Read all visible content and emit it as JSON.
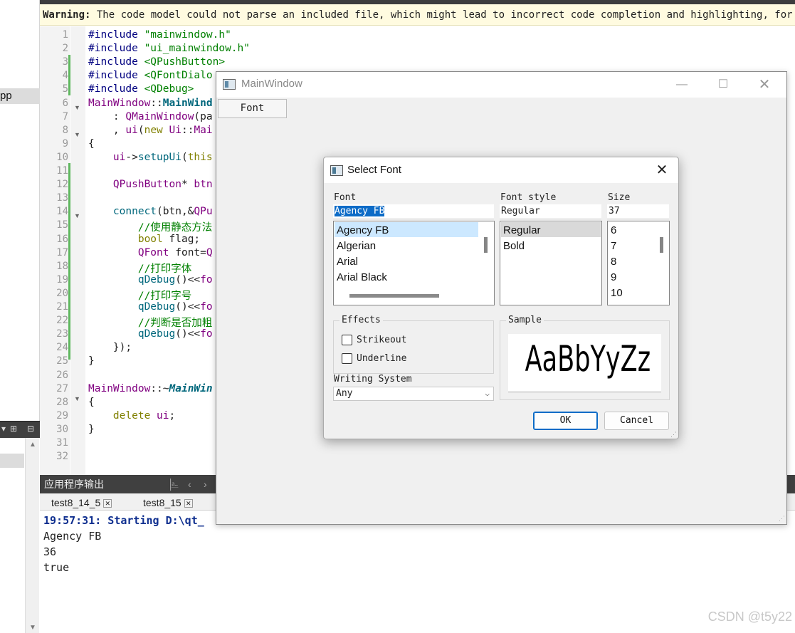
{
  "warning": {
    "prefix": "Warning:",
    "text": " The code model could not parse an included file, which might lead to incorrect code completion and highlighting, for exampl"
  },
  "sidebar": {
    "cpp_label": "pp"
  },
  "editor": {
    "lines": [
      {
        "n": "1",
        "segs": [
          [
            "pp",
            "#include "
          ],
          [
            "str",
            "\"mainwindow.h\""
          ]
        ]
      },
      {
        "n": "2",
        "segs": [
          [
            "pp",
            "#include "
          ],
          [
            "str",
            "\"ui_mainwindow.h\""
          ]
        ]
      },
      {
        "n": "3",
        "segs": [
          [
            "pp",
            "#include "
          ],
          [
            "inc",
            "<QPushButton>"
          ]
        ]
      },
      {
        "n": "4",
        "segs": [
          [
            "pp",
            "#include "
          ],
          [
            "inc",
            "<QFontDialo"
          ]
        ]
      },
      {
        "n": "5",
        "segs": [
          [
            "pp",
            "#include "
          ],
          [
            "inc",
            "<QDebug>"
          ]
        ]
      },
      {
        "n": "6",
        "segs": [
          [
            "cls",
            "MainWindow"
          ],
          [
            "txt",
            "::"
          ],
          [
            "fnb",
            "MainWind"
          ]
        ]
      },
      {
        "n": "7",
        "segs": [
          [
            "txt",
            "    : "
          ],
          [
            "cls",
            "QMainWindow"
          ],
          [
            "txt",
            "(pa"
          ]
        ]
      },
      {
        "n": "8",
        "segs": [
          [
            "txt",
            "    , "
          ],
          [
            "cls",
            "ui"
          ],
          [
            "txt",
            "("
          ],
          [
            "kw",
            "new "
          ],
          [
            "cls",
            "Ui"
          ],
          [
            "txt",
            "::"
          ],
          [
            "cls",
            "Mai"
          ]
        ]
      },
      {
        "n": "9",
        "segs": [
          [
            "txt",
            "{"
          ]
        ]
      },
      {
        "n": "10",
        "segs": [
          [
            "txt",
            "    "
          ],
          [
            "cls",
            "ui"
          ],
          [
            "txt",
            "->"
          ],
          [
            "fn",
            "setupUi"
          ],
          [
            "txt",
            "("
          ],
          [
            "kw",
            "this"
          ]
        ]
      },
      {
        "n": "11",
        "segs": [
          [
            "txt",
            ""
          ]
        ]
      },
      {
        "n": "12",
        "segs": [
          [
            "txt",
            "    "
          ],
          [
            "cls",
            "QPushButton"
          ],
          [
            "txt",
            "* "
          ],
          [
            "cls",
            "btn"
          ]
        ]
      },
      {
        "n": "13",
        "segs": [
          [
            "txt",
            ""
          ]
        ]
      },
      {
        "n": "14",
        "segs": [
          [
            "txt",
            "    "
          ],
          [
            "fn",
            "connect"
          ],
          [
            "txt",
            "(btn,&"
          ],
          [
            "cls",
            "QPu"
          ]
        ]
      },
      {
        "n": "15",
        "segs": [
          [
            "txt",
            "        "
          ],
          [
            "cm",
            "//使用静态方法"
          ]
        ]
      },
      {
        "n": "16",
        "segs": [
          [
            "txt",
            "        "
          ],
          [
            "kw",
            "bool "
          ],
          [
            "txt",
            "flag;"
          ]
        ]
      },
      {
        "n": "17",
        "segs": [
          [
            "txt",
            "        "
          ],
          [
            "cls",
            "QFont "
          ],
          [
            "txt",
            "font="
          ],
          [
            "cls",
            "Q"
          ]
        ]
      },
      {
        "n": "18",
        "segs": [
          [
            "txt",
            "        "
          ],
          [
            "cm",
            "//打印字体"
          ]
        ]
      },
      {
        "n": "19",
        "segs": [
          [
            "txt",
            "        "
          ],
          [
            "fn",
            "qDebug"
          ],
          [
            "txt",
            "()<<"
          ],
          [
            "cls",
            "fo"
          ]
        ]
      },
      {
        "n": "20",
        "segs": [
          [
            "txt",
            "        "
          ],
          [
            "cm",
            "//打印字号"
          ]
        ]
      },
      {
        "n": "21",
        "segs": [
          [
            "txt",
            "        "
          ],
          [
            "fn",
            "qDebug"
          ],
          [
            "txt",
            "()<<"
          ],
          [
            "cls",
            "fo"
          ]
        ]
      },
      {
        "n": "22",
        "segs": [
          [
            "txt",
            "        "
          ],
          [
            "cm",
            "//判断是否加粗"
          ]
        ]
      },
      {
        "n": "23",
        "segs": [
          [
            "txt",
            "        "
          ],
          [
            "fn",
            "qDebug"
          ],
          [
            "txt",
            "()<<"
          ],
          [
            "cls",
            "fo"
          ]
        ]
      },
      {
        "n": "24",
        "segs": [
          [
            "txt",
            "    });"
          ]
        ]
      },
      {
        "n": "25",
        "segs": [
          [
            "txt",
            "}"
          ]
        ]
      },
      {
        "n": "26",
        "segs": [
          [
            "txt",
            ""
          ]
        ]
      },
      {
        "n": "27",
        "segs": [
          [
            "cls",
            "MainWindow"
          ],
          [
            "txt",
            "::~"
          ],
          [
            "it",
            "MainWin"
          ]
        ]
      },
      {
        "n": "28",
        "segs": [
          [
            "txt",
            "{"
          ]
        ]
      },
      {
        "n": "29",
        "segs": [
          [
            "txt",
            "    "
          ],
          [
            "kw",
            "delete "
          ],
          [
            "cls",
            "ui"
          ],
          [
            "txt",
            ";"
          ]
        ]
      },
      {
        "n": "30",
        "segs": [
          [
            "txt",
            "}"
          ]
        ]
      },
      {
        "n": "31",
        "segs": [
          [
            "txt",
            ""
          ]
        ]
      },
      {
        "n": "32",
        "segs": [
          [
            "txt",
            ""
          ]
        ]
      }
    ]
  },
  "output": {
    "title": "应用程序输出",
    "tabs": [
      "test8_14_5",
      "test8_15"
    ],
    "lines": [
      "19:57:31: Starting D:\\qt_",
      "Agency FB",
      "36",
      "true"
    ]
  },
  "watermark": "CSDN @t5y22",
  "main_window": {
    "title": "MainWindow",
    "font_button": "Font"
  },
  "font_dialog": {
    "title": "Select Font",
    "font_label": "Font",
    "font_value": "Agency FB",
    "fonts": [
      "Agency FB",
      "Algerian",
      "Arial",
      "Arial Black"
    ],
    "style_label": "Font style",
    "style_value": "Regular",
    "styles": [
      "Regular",
      "Bold"
    ],
    "size_label": "Size",
    "size_value": "37",
    "sizes": [
      "6",
      "7",
      "8",
      "9",
      "10"
    ],
    "effects_label": "Effects",
    "strikeout_label": "Strikeout",
    "underline_label": "Underline",
    "writing_system_label": "Writing System",
    "writing_system_value": "Any",
    "sample_label": "Sample",
    "sample_text": "AaBbYyZz",
    "ok_label": "OK",
    "cancel_label": "Cancel"
  },
  "colors": {
    "selection": "#0c6bc7",
    "list_highlight": "#cce8ff",
    "output_header": "#404040"
  }
}
